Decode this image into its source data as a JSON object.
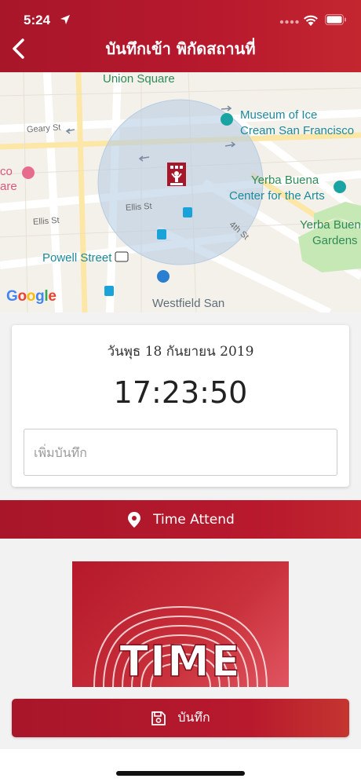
{
  "status_bar": {
    "time": "5:24"
  },
  "header": {
    "title": "บันทึกเข้า พิกัดสถานที่"
  },
  "map": {
    "labels": {
      "union_square": "Union Square",
      "geary_st": "Geary St",
      "museum_line1": "Museum of Ice",
      "museum_line2": "Cream San Francisco",
      "yerba_center_line1": "Yerba Buena",
      "yerba_center_line2": "Center for the Arts",
      "yerba_gardens_line1": "Yerba Buen",
      "yerba_gardens_line2": "Gardens",
      "ellis_st_1": "Ellis St",
      "ellis_st_2": "Ellis St",
      "fourth_st": "4th St",
      "powell_street": "Powell Street",
      "westfield": "Westfield San",
      "left_partial_1": "co",
      "left_partial_2": "are",
      "google": "Google"
    }
  },
  "card": {
    "date": "วันพุธ 18 กันยายน 2019",
    "time": "17:23:50",
    "note_placeholder": "เพิ่มบันทึก"
  },
  "attend_bar": {
    "label": "Time Attend"
  },
  "promo": {
    "word": "TIME"
  },
  "save_button": {
    "label": "บันทึก"
  }
}
